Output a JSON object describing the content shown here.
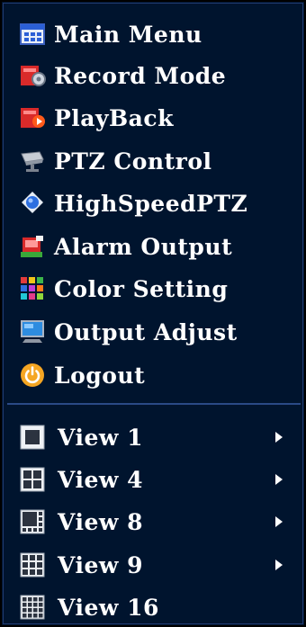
{
  "menu": {
    "items": [
      {
        "label": "Main Menu",
        "icon": "main-menu-icon"
      },
      {
        "label": "Record Mode",
        "icon": "record-mode-icon"
      },
      {
        "label": "PlayBack",
        "icon": "playback-icon"
      },
      {
        "label": "PTZ Control",
        "icon": "ptz-camera-icon"
      },
      {
        "label": "HighSpeedPTZ",
        "icon": "high-speed-ptz-icon"
      },
      {
        "label": "Alarm Output",
        "icon": "alarm-output-icon"
      },
      {
        "label": "Color Setting",
        "icon": "color-grid-icon"
      },
      {
        "label": "Output Adjust",
        "icon": "monitor-icon"
      },
      {
        "label": "Logout",
        "icon": "power-icon"
      }
    ],
    "views": [
      {
        "label": "View 1",
        "icon": "view-1-icon",
        "has_submenu": true
      },
      {
        "label": "View 4",
        "icon": "view-4-icon",
        "has_submenu": true
      },
      {
        "label": "View 8",
        "icon": "view-8-icon",
        "has_submenu": true
      },
      {
        "label": "View 9",
        "icon": "view-9-icon",
        "has_submenu": true
      },
      {
        "label": "View 16",
        "icon": "view-16-icon",
        "has_submenu": false
      }
    ]
  },
  "colors": {
    "background": "#00142e",
    "text": "#ffffff",
    "divider": "#2a4a86"
  }
}
